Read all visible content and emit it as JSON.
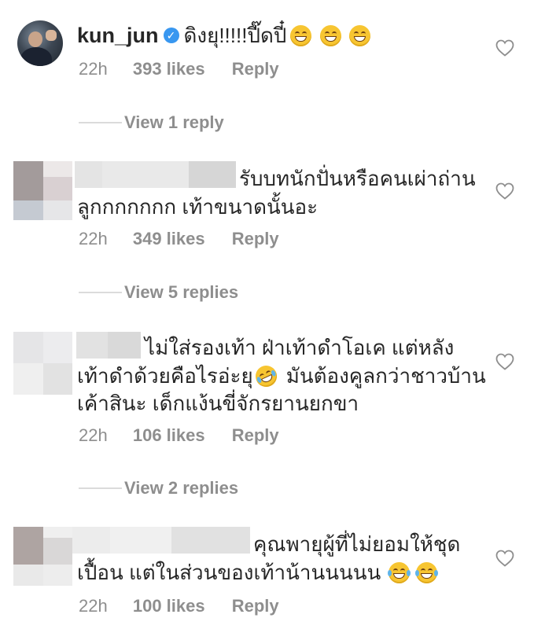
{
  "comments": [
    {
      "username": "kun_jun",
      "text_lines": [
        "ดิงยุ!!!!!ปี๊ดปี๋"
      ],
      "time": "22h",
      "likes": "393 likes",
      "reply": "Reply",
      "view_replies": "View 1 reply"
    },
    {
      "text_lines": [
        "รับบทนักปั่นหรือคนเผ่าถ่าน",
        "ลูกกกกกกก เท้าขนาดนั้นอะ"
      ],
      "time": "22h",
      "likes": "349 likes",
      "reply": "Reply",
      "view_replies": "View 5 replies"
    },
    {
      "text_lines": [
        "ไม่ใส่รองเท้า ฝ่าเท้าดำโอเค แต่หลัง",
        "เท้าดำด้วยคือไรอ่ะยุ",
        "มันต้องคูลกว่าชาวบ้าน",
        "เค้าสินะ เด็กแง้นขี่จักรยานยกขา"
      ],
      "time": "22h",
      "likes": "106 likes",
      "reply": "Reply",
      "view_replies": "View 2 replies"
    },
    {
      "text_lines": [
        "คุณพายุผู้ที่ไม่ยอมให้ชุด",
        "เปื้อน แต่ในส่วนของเท้าน้านนนนน"
      ],
      "time": "22h",
      "likes": "100 likes",
      "reply": "Reply"
    }
  ],
  "colors": {
    "text": "#262626",
    "secondary": "#8e8e8e",
    "verified": "#3897f0",
    "divider": "#dbdbdb"
  },
  "icons": [
    "verified-badge-icon",
    "heart-outline-icon",
    "grinning-emoji-icon",
    "tears-of-joy-emoji-icon"
  ]
}
